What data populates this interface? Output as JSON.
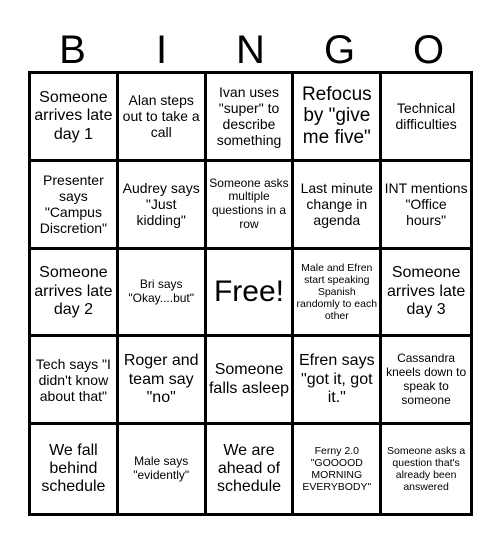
{
  "header": {
    "letters": [
      "B",
      "I",
      "N",
      "G",
      "O"
    ]
  },
  "cells": [
    [
      "Someone arrives late day 1",
      "Alan steps out to take a call",
      "Ivan uses \"super\" to describe something",
      "Refocus by \"give me five\"",
      "Technical difficulties"
    ],
    [
      "Presenter says \"Campus Discretion\"",
      "Audrey says \"Just kidding\"",
      "Someone asks multiple questions in a row",
      "Last minute change in agenda",
      "INT mentions \"Office hours\""
    ],
    [
      "Someone arrives late day 2",
      "Bri says \"Okay....but\"",
      "Free!",
      "Male and Efren start speaking Spanish randomly to each other",
      "Someone arrives late day 3"
    ],
    [
      "Tech says \"I didn't know about that\"",
      "Roger and team say \"no\"",
      "Someone falls asleep",
      "Efren says \"got it, got it.\"",
      "Cassandra kneels down to speak to someone"
    ],
    [
      "We fall behind schedule",
      "Male says \"evidently\"",
      "We are ahead of schedule",
      "Ferny 2.0 \"GOOOOD MORNING EVERYBODY\"",
      "Someone asks a question that's already been answered"
    ]
  ]
}
